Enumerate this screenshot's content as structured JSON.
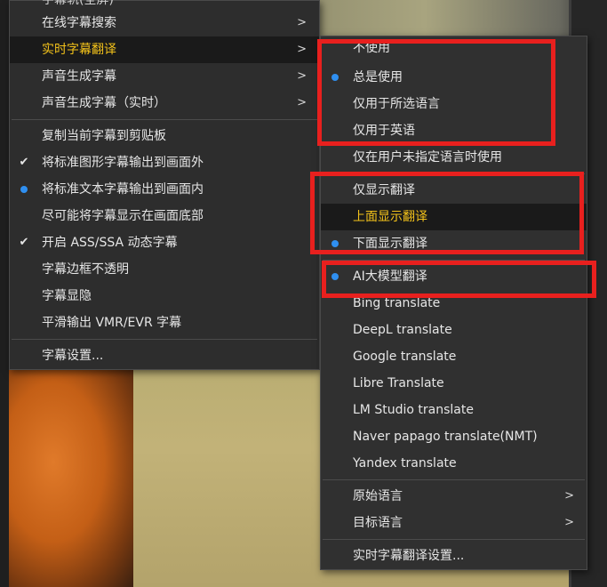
{
  "menu_main": {
    "partial_top": "字幕轨(全屏)",
    "items": [
      {
        "label": "在线字幕搜索"
      },
      {
        "label": "实时字幕翻译"
      },
      {
        "label": "声音生成字幕"
      },
      {
        "label": "声音生成字幕（实时）"
      },
      {
        "label": "复制当前字幕到剪贴板"
      },
      {
        "label": "将标准图形字幕输出到画面外"
      },
      {
        "label": "将标准文本字幕输出到画面内"
      },
      {
        "label": "尽可能将字幕显示在画面底部"
      },
      {
        "label": "开启 ASS/SSA 动态字幕"
      },
      {
        "label": "字幕边框不透明"
      },
      {
        "label": "字幕显隐"
      },
      {
        "label": "平滑输出 VMR/EVR 字幕"
      },
      {
        "label": "字幕设置..."
      }
    ]
  },
  "submenu_translate": {
    "items": [
      {
        "label": "不使用"
      },
      {
        "label": "总是使用"
      },
      {
        "label": "仅用于所选语言"
      },
      {
        "label": "仅用于英语"
      },
      {
        "label": "仅在用户未指定语言时使用"
      },
      {
        "label": "仅显示翻译"
      },
      {
        "label": "上面显示翻译"
      },
      {
        "label": "下面显示翻译"
      },
      {
        "label": "AI大模型翻译"
      },
      {
        "label": "Bing translate"
      },
      {
        "label": "DeepL translate"
      },
      {
        "label": "Google translate"
      },
      {
        "label": "Libre Translate"
      },
      {
        "label": "LM Studio translate"
      },
      {
        "label": "Naver papago translate(NMT)"
      },
      {
        "label": "Yandex translate"
      },
      {
        "label": "原始语言"
      },
      {
        "label": "目标语言"
      },
      {
        "label": "实时字幕翻译设置..."
      }
    ]
  },
  "icons": {
    "submenu_arrow": ">",
    "check": "✔"
  },
  "colors": {
    "highlight_text": "#f3c21a",
    "radio_dot": "#2f8ff0",
    "annotation_red": "#e8201e"
  }
}
